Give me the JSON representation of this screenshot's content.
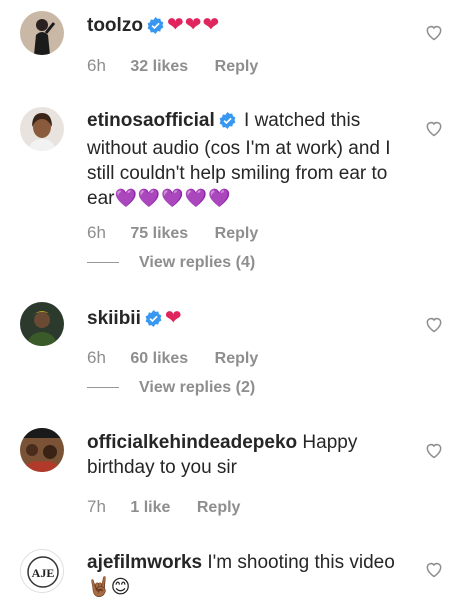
{
  "comments": [
    {
      "username": "toolzo",
      "verified": true,
      "text": "",
      "emoji": "❤❤❤",
      "time": "6h",
      "likes": "32 likes",
      "reply": "Reply"
    },
    {
      "username": "etinosaofficial",
      "verified": true,
      "text": "I watched this without audio (cos I'm at work) and I still couldn't help smiling from ear to ear",
      "emoji": "💜💜💜💜💜",
      "time": "6h",
      "likes": "75 likes",
      "reply": "Reply",
      "view_replies": "View replies (4)"
    },
    {
      "username": "skiibii",
      "verified": true,
      "text": "",
      "emoji": "❤",
      "time": "6h",
      "likes": "60 likes",
      "reply": "Reply",
      "view_replies": "View replies (2)"
    },
    {
      "username": "officialkehindeadepeko",
      "verified": false,
      "text": "Happy birthday to you sir",
      "time": "7h",
      "likes": "1 like",
      "reply": "Reply"
    },
    {
      "username": "ajefilmworks",
      "verified": false,
      "text": "I'm shooting this video",
      "emoji": "🤘🏾😊",
      "avatar_logo_text": "AJE"
    }
  ],
  "icons": {
    "like": "heart-outline-icon",
    "verified": "verified-badge-icon"
  },
  "colors": {
    "verified": "#3897f0",
    "heart": "#e0245e",
    "muted": "#8e8e8e"
  }
}
